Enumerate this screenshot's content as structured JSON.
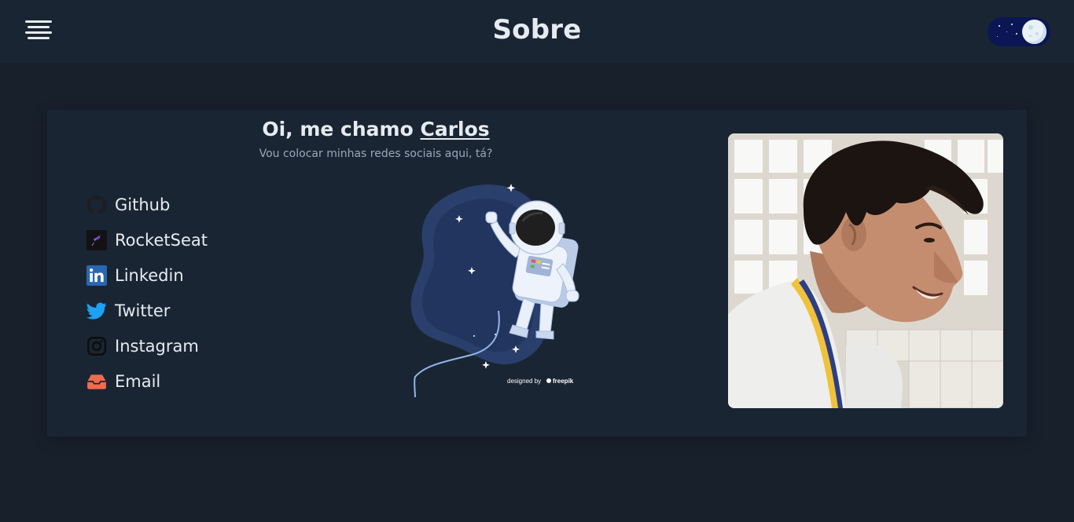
{
  "header": {
    "title": "Sobre",
    "menu_icon": "hamburger-menu-icon",
    "theme_toggle_icon": "moon-icon"
  },
  "intro": {
    "greeting_prefix": "Oi, me chamo ",
    "name": "Carlos",
    "subtitle": "Vou colocar minhas redes sociais aqui, tá?"
  },
  "social_links": [
    {
      "label": "Github",
      "icon": "github-icon",
      "color": "#1b1f23"
    },
    {
      "label": "RocketSeat",
      "icon": "rocketseat-icon",
      "color": "#8257e5"
    },
    {
      "label": "Linkedin",
      "icon": "linkedin-icon",
      "color": "#2867b2"
    },
    {
      "label": "Twitter",
      "icon": "twitter-icon",
      "color": "#1da1f2"
    },
    {
      "label": "Instagram",
      "icon": "instagram-icon",
      "color": "#0d0d0d"
    },
    {
      "label": "Email",
      "icon": "inbox-icon",
      "color": "#f26b4d"
    }
  ],
  "illustration": {
    "credit_prefix": "designed by",
    "credit_brand": "freepik"
  },
  "colors": {
    "background": "#18202c",
    "header": "#1a2533",
    "card": "#1a2533",
    "text": "#e6ebf1",
    "muted_text": "#9aa7b6",
    "toggle_track": "#0b1654"
  }
}
